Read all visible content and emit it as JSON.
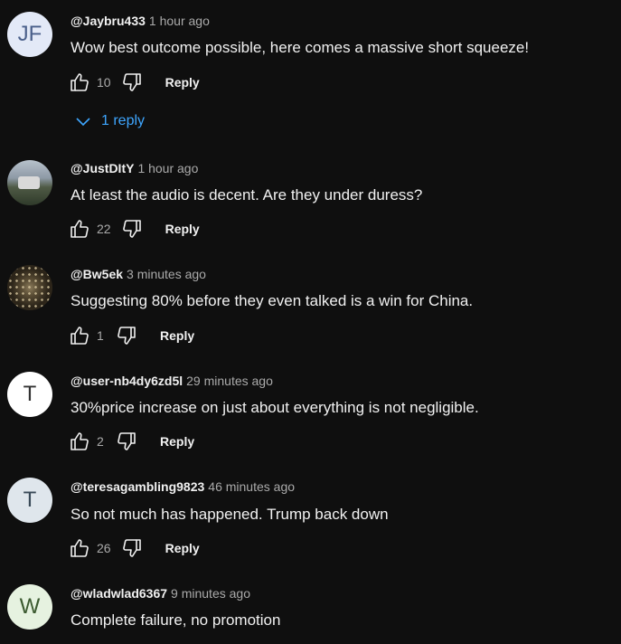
{
  "comments": [
    {
      "avatar_text": "JF",
      "handle": "@Jaybru433",
      "time": "1 hour ago",
      "text": "Wow best outcome possible, here comes a massive short squeeze!",
      "likes": "10",
      "reply_label": "Reply",
      "replies_label": "1 reply"
    },
    {
      "avatar_text": "",
      "handle": "@JustDItY",
      "time": "1 hour ago",
      "text": "At least the audio is decent.  Are they under duress?",
      "likes": "22",
      "reply_label": "Reply"
    },
    {
      "avatar_text": "",
      "handle": "@Bw5ek",
      "time": "3 minutes ago",
      "text": "Suggesting 80% before they even talked is a win for China.",
      "likes": "1",
      "reply_label": "Reply"
    },
    {
      "avatar_text": "T",
      "handle": "@user-nb4dy6zd5l",
      "time": "29 minutes ago",
      "text": "30%price increase on just about everything is not negligible.",
      "likes": "2",
      "reply_label": "Reply"
    },
    {
      "avatar_text": "T",
      "handle": "@teresagambling9823",
      "time": "46 minutes ago",
      "text": "So not much has happened. Trump back down",
      "likes": "26",
      "reply_label": "Reply"
    },
    {
      "avatar_text": "W",
      "handle": "@wladwlad6367",
      "time": "9 minutes ago",
      "text": "Complete failure, no promotion"
    }
  ],
  "icons": {
    "like": "thumbs-up-icon",
    "dislike": "thumbs-down-icon",
    "expand": "chevron-down-icon"
  },
  "colors": {
    "background": "#0f0f0f",
    "text": "#f1f1f1",
    "secondary_text": "#aaaaaa",
    "link": "#3ea6ff"
  }
}
